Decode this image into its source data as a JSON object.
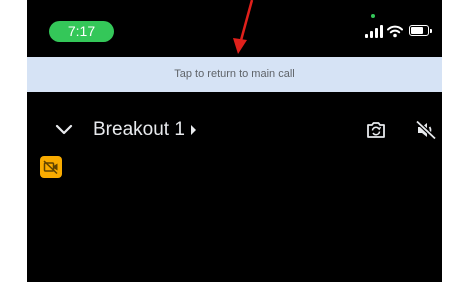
{
  "status_bar": {
    "time": "7:17"
  },
  "banner": {
    "text": "Tap to return to main call"
  },
  "header": {
    "title": "Breakout 1"
  },
  "icons": {
    "collapse": "chevron-down-icon",
    "switch_camera": "camera-switch-icon",
    "audio": "speaker-muted-icon",
    "badge": "video-off-icon"
  },
  "colors": {
    "time_pill": "#34c759",
    "banner_bg": "#d6e3f5",
    "badge": "#f9ab00",
    "annotation_arrow": "#e0201b"
  }
}
